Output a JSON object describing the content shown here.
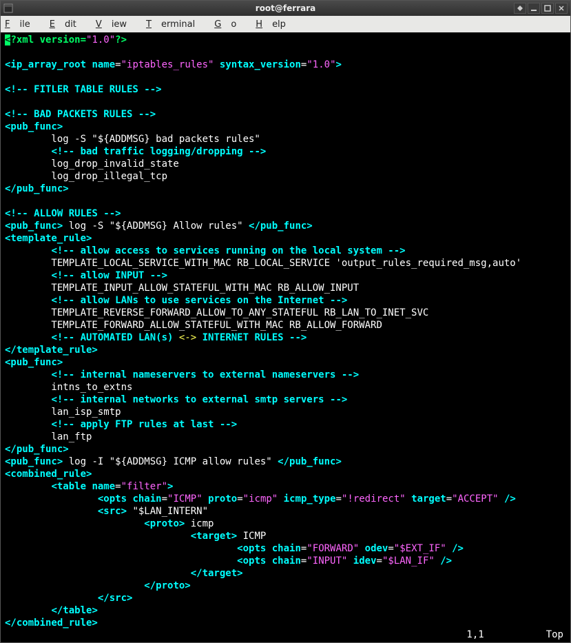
{
  "window": {
    "title": "root@ferrara"
  },
  "menu": [
    "File",
    "Edit",
    "View",
    "Terminal",
    "Go",
    "Help"
  ],
  "status": {
    "pos": "1,1",
    "loc": "Top"
  },
  "lines": [
    [
      {
        "t": "<",
        "c": "cursor"
      },
      {
        "t": "?xml version=",
        "c": "green"
      },
      {
        "t": "\"1.0\"",
        "c": "c-str"
      },
      {
        "t": "?>",
        "c": "green"
      }
    ],
    [],
    [
      {
        "t": "<ip_array_root",
        "c": "c-tag"
      },
      {
        "t": " ",
        "c": "c-def"
      },
      {
        "t": "name",
        "c": "c-attr"
      },
      {
        "t": "=",
        "c": "c-eq"
      },
      {
        "t": "\"iptables_rules\"",
        "c": "c-str"
      },
      {
        "t": " ",
        "c": "c-def"
      },
      {
        "t": "syntax_version",
        "c": "c-attr"
      },
      {
        "t": "=",
        "c": "c-eq"
      },
      {
        "t": "\"1.0\"",
        "c": "c-str"
      },
      {
        "t": ">",
        "c": "c-tag"
      }
    ],
    [],
    [
      {
        "t": "<!-- FITLER TABLE RULES -->",
        "c": "c-cmt"
      }
    ],
    [],
    [
      {
        "t": "<!-- BAD PACKETS RULES -->",
        "c": "c-cmt"
      }
    ],
    [
      {
        "t": "<pub_func>",
        "c": "c-tag"
      }
    ],
    [
      {
        "t": "        log -S \"${ADDMSG} bad packets rules\"",
        "c": "c-txt"
      }
    ],
    [
      {
        "t": "        ",
        "c": "c-txt"
      },
      {
        "t": "<!-- bad traffic logging/dropping -->",
        "c": "c-cmt"
      }
    ],
    [
      {
        "t": "        log_drop_invalid_state",
        "c": "c-txt"
      }
    ],
    [
      {
        "t": "        log_drop_illegal_tcp",
        "c": "c-txt"
      }
    ],
    [
      {
        "t": "</pub_func>",
        "c": "c-tag"
      }
    ],
    [],
    [
      {
        "t": "<!-- ALLOW RULES -->",
        "c": "c-cmt"
      }
    ],
    [
      {
        "t": "<pub_func>",
        "c": "c-tag"
      },
      {
        "t": " log -S \"${ADDMSG} Allow rules\" ",
        "c": "c-txt"
      },
      {
        "t": "</pub_func>",
        "c": "c-tag"
      }
    ],
    [
      {
        "t": "<template_rule>",
        "c": "c-tag"
      }
    ],
    [
      {
        "t": "        ",
        "c": "c-txt"
      },
      {
        "t": "<!-- allow access to services running on the local system -->",
        "c": "c-cmt"
      }
    ],
    [
      {
        "t": "        TEMPLATE_LOCAL_SERVICE_WITH_MAC RB_LOCAL_SERVICE 'output_rules_required_msg,auto'",
        "c": "c-txt"
      }
    ],
    [
      {
        "t": "        ",
        "c": "c-txt"
      },
      {
        "t": "<!-- allow INPUT -->",
        "c": "c-cmt"
      }
    ],
    [
      {
        "t": "        TEMPLATE_INPUT_ALLOW_STATEFUL_WITH_MAC RB_ALLOW_INPUT",
        "c": "c-txt"
      }
    ],
    [
      {
        "t": "        ",
        "c": "c-txt"
      },
      {
        "t": "<!-- allow LANs to use services on the Internet -->",
        "c": "c-cmt"
      }
    ],
    [
      {
        "t": "        TEMPLATE_REVERSE_FORWARD_ALLOW_TO_ANY_STATEFUL RB_LAN_TO_INET_SVC",
        "c": "c-txt"
      }
    ],
    [
      {
        "t": "        TEMPLATE_FORWARD_ALLOW_STATEFUL_WITH_MAC RB_ALLOW_FORWARD",
        "c": "c-txt"
      }
    ],
    [
      {
        "t": "        ",
        "c": "c-txt"
      },
      {
        "t": "<!-- AUTOMATED LAN(s) ",
        "c": "c-cmt"
      },
      {
        "t": "<->",
        "c": "c-kw"
      },
      {
        "t": " INTERNET RULES -->",
        "c": "c-cmt"
      }
    ],
    [
      {
        "t": "</template_rule>",
        "c": "c-tag"
      }
    ],
    [
      {
        "t": "<pub_func>",
        "c": "c-tag"
      }
    ],
    [
      {
        "t": "        ",
        "c": "c-txt"
      },
      {
        "t": "<!-- internal nameservers to external nameservers -->",
        "c": "c-cmt"
      }
    ],
    [
      {
        "t": "        intns_to_extns",
        "c": "c-txt"
      }
    ],
    [
      {
        "t": "        ",
        "c": "c-txt"
      },
      {
        "t": "<!-- internal networks to external smtp servers -->",
        "c": "c-cmt"
      }
    ],
    [
      {
        "t": "        lan_isp_smtp",
        "c": "c-txt"
      }
    ],
    [
      {
        "t": "        ",
        "c": "c-txt"
      },
      {
        "t": "<!-- apply FTP rules at last -->",
        "c": "c-cmt"
      }
    ],
    [
      {
        "t": "        lan_ftp",
        "c": "c-txt"
      }
    ],
    [
      {
        "t": "</pub_func>",
        "c": "c-tag"
      }
    ],
    [
      {
        "t": "<pub_func>",
        "c": "c-tag"
      },
      {
        "t": " log -I \"${ADDMSG} ICMP allow rules\" ",
        "c": "c-txt"
      },
      {
        "t": "</pub_func>",
        "c": "c-tag"
      }
    ],
    [
      {
        "t": "<combined_rule>",
        "c": "c-tag"
      }
    ],
    [
      {
        "t": "        ",
        "c": "c-txt"
      },
      {
        "t": "<table",
        "c": "c-tag"
      },
      {
        "t": " ",
        "c": "c-def"
      },
      {
        "t": "name",
        "c": "c-attr"
      },
      {
        "t": "=",
        "c": "c-eq"
      },
      {
        "t": "\"filter\"",
        "c": "c-str"
      },
      {
        "t": ">",
        "c": "c-tag"
      }
    ],
    [
      {
        "t": "                ",
        "c": "c-txt"
      },
      {
        "t": "<opts",
        "c": "c-tag"
      },
      {
        "t": " ",
        "c": "c-def"
      },
      {
        "t": "chain",
        "c": "c-attr"
      },
      {
        "t": "=",
        "c": "c-eq"
      },
      {
        "t": "\"ICMP\"",
        "c": "c-str"
      },
      {
        "t": " ",
        "c": "c-def"
      },
      {
        "t": "proto",
        "c": "c-attr"
      },
      {
        "t": "=",
        "c": "c-eq"
      },
      {
        "t": "\"icmp\"",
        "c": "c-str"
      },
      {
        "t": " ",
        "c": "c-def"
      },
      {
        "t": "icmp_type",
        "c": "c-attr"
      },
      {
        "t": "=",
        "c": "c-eq"
      },
      {
        "t": "\"!redirect\"",
        "c": "c-str"
      },
      {
        "t": " ",
        "c": "c-def"
      },
      {
        "t": "target",
        "c": "c-attr"
      },
      {
        "t": "=",
        "c": "c-eq"
      },
      {
        "t": "\"ACCEPT\"",
        "c": "c-str"
      },
      {
        "t": " />",
        "c": "c-tag"
      }
    ],
    [
      {
        "t": "                ",
        "c": "c-txt"
      },
      {
        "t": "<src>",
        "c": "c-tag"
      },
      {
        "t": " \"$LAN_INTERN\"",
        "c": "c-txt"
      }
    ],
    [
      {
        "t": "                        ",
        "c": "c-txt"
      },
      {
        "t": "<proto>",
        "c": "c-tag"
      },
      {
        "t": " icmp",
        "c": "c-txt"
      }
    ],
    [
      {
        "t": "                                ",
        "c": "c-txt"
      },
      {
        "t": "<target>",
        "c": "c-tag"
      },
      {
        "t": " ICMP",
        "c": "c-txt"
      }
    ],
    [
      {
        "t": "                                        ",
        "c": "c-txt"
      },
      {
        "t": "<opts",
        "c": "c-tag"
      },
      {
        "t": " ",
        "c": "c-def"
      },
      {
        "t": "chain",
        "c": "c-attr"
      },
      {
        "t": "=",
        "c": "c-eq"
      },
      {
        "t": "\"FORWARD\"",
        "c": "c-str"
      },
      {
        "t": " ",
        "c": "c-def"
      },
      {
        "t": "odev",
        "c": "c-attr"
      },
      {
        "t": "=",
        "c": "c-eq"
      },
      {
        "t": "\"$EXT_IF\"",
        "c": "c-str"
      },
      {
        "t": " />",
        "c": "c-tag"
      }
    ],
    [
      {
        "t": "                                        ",
        "c": "c-txt"
      },
      {
        "t": "<opts",
        "c": "c-tag"
      },
      {
        "t": " ",
        "c": "c-def"
      },
      {
        "t": "chain",
        "c": "c-attr"
      },
      {
        "t": "=",
        "c": "c-eq"
      },
      {
        "t": "\"INPUT\"",
        "c": "c-str"
      },
      {
        "t": " ",
        "c": "c-def"
      },
      {
        "t": "idev",
        "c": "c-attr"
      },
      {
        "t": "=",
        "c": "c-eq"
      },
      {
        "t": "\"$LAN_IF\"",
        "c": "c-str"
      },
      {
        "t": " />",
        "c": "c-tag"
      }
    ],
    [
      {
        "t": "                                ",
        "c": "c-txt"
      },
      {
        "t": "</target>",
        "c": "c-tag"
      }
    ],
    [
      {
        "t": "                        ",
        "c": "c-txt"
      },
      {
        "t": "</proto>",
        "c": "c-tag"
      }
    ],
    [
      {
        "t": "                ",
        "c": "c-txt"
      },
      {
        "t": "</src>",
        "c": "c-tag"
      }
    ],
    [
      {
        "t": "        ",
        "c": "c-txt"
      },
      {
        "t": "</table>",
        "c": "c-tag"
      }
    ],
    [
      {
        "t": "</combined_rule>",
        "c": "c-tag"
      }
    ]
  ]
}
